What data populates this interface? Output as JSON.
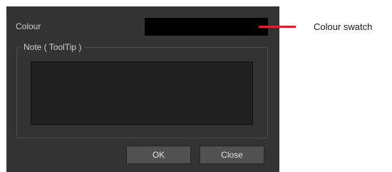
{
  "dialog": {
    "colour_label": "Colour",
    "colour_swatch_color": "#000000",
    "note_group_label": "Note ( ToolTip )",
    "note_value": "",
    "ok_label": "OK",
    "close_label": "Close"
  },
  "annotation": {
    "callout_text": "Colour swatch",
    "callout_color": "#e31e24"
  }
}
